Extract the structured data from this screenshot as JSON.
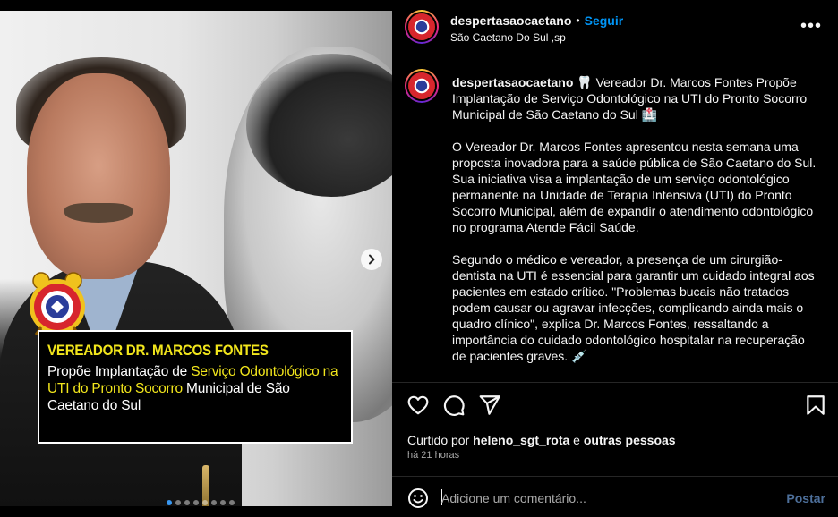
{
  "post": {
    "username": "despertasaocaetano",
    "follow_label": "Seguir",
    "separator": "•",
    "location": "São Caetano Do Sul ,sp",
    "more_label": "•••"
  },
  "media": {
    "overlay_title": "VEREADOR DR. MARCOS FONTES",
    "overlay_line_a": "Propõe Implantação de ",
    "overlay_highlight": "Serviço Odontológico na UTI do Pronto Socorro",
    "overlay_line_b": " Municipal de São Caetano do Sul",
    "carousel_count": 8,
    "carousel_active_index": 0
  },
  "caption": {
    "username": "despertasaocaetano",
    "headline": "🦷 Vereador Dr. Marcos Fontes Propõe Implantação de Serviço Odontológico na UTI do Pronto Socorro Municipal de São Caetano do Sul 🏥",
    "paragraph_1": "O Vereador Dr. Marcos Fontes apresentou nesta semana uma proposta inovadora para a saúde pública de São Caetano do Sul. Sua iniciativa visa a implantação de um serviço odontológico permanente na Unidade de Terapia Intensiva (UTI) do Pronto Socorro Municipal, além de expandir o atendimento odontológico no programa Atende Fácil Saúde.",
    "paragraph_2": "Segundo o médico e vereador, a presença de um cirurgião-dentista na UTI é essencial para garantir um cuidado integral aos pacientes em estado crítico. \"Problemas bucais não tratados podem causar ou agravar infecções, complicando ainda mais o quadro clínico\", explica Dr. Marcos Fontes, ressaltando a importância do cuidado odontológico hospitalar na recuperação de pacientes graves. 💉"
  },
  "engagement": {
    "liked_prefix": "Curtido por ",
    "liked_user": "heleno_sgt_rota",
    "liked_join": " e ",
    "liked_others": "outras pessoas",
    "time_ago": "há 21 horas"
  },
  "comment": {
    "placeholder": "Adicione um comentário...",
    "post_label": "Postar"
  },
  "icons": {
    "like": "heart-icon",
    "comment": "comment-icon",
    "share": "share-icon",
    "save": "bookmark-icon",
    "emoji": "emoji-icon",
    "next": "chevron-right-icon",
    "more": "more-icon"
  },
  "colors": {
    "accent": "#0095f6",
    "overlay_highlight": "#f2e61c",
    "background": "#000000"
  }
}
